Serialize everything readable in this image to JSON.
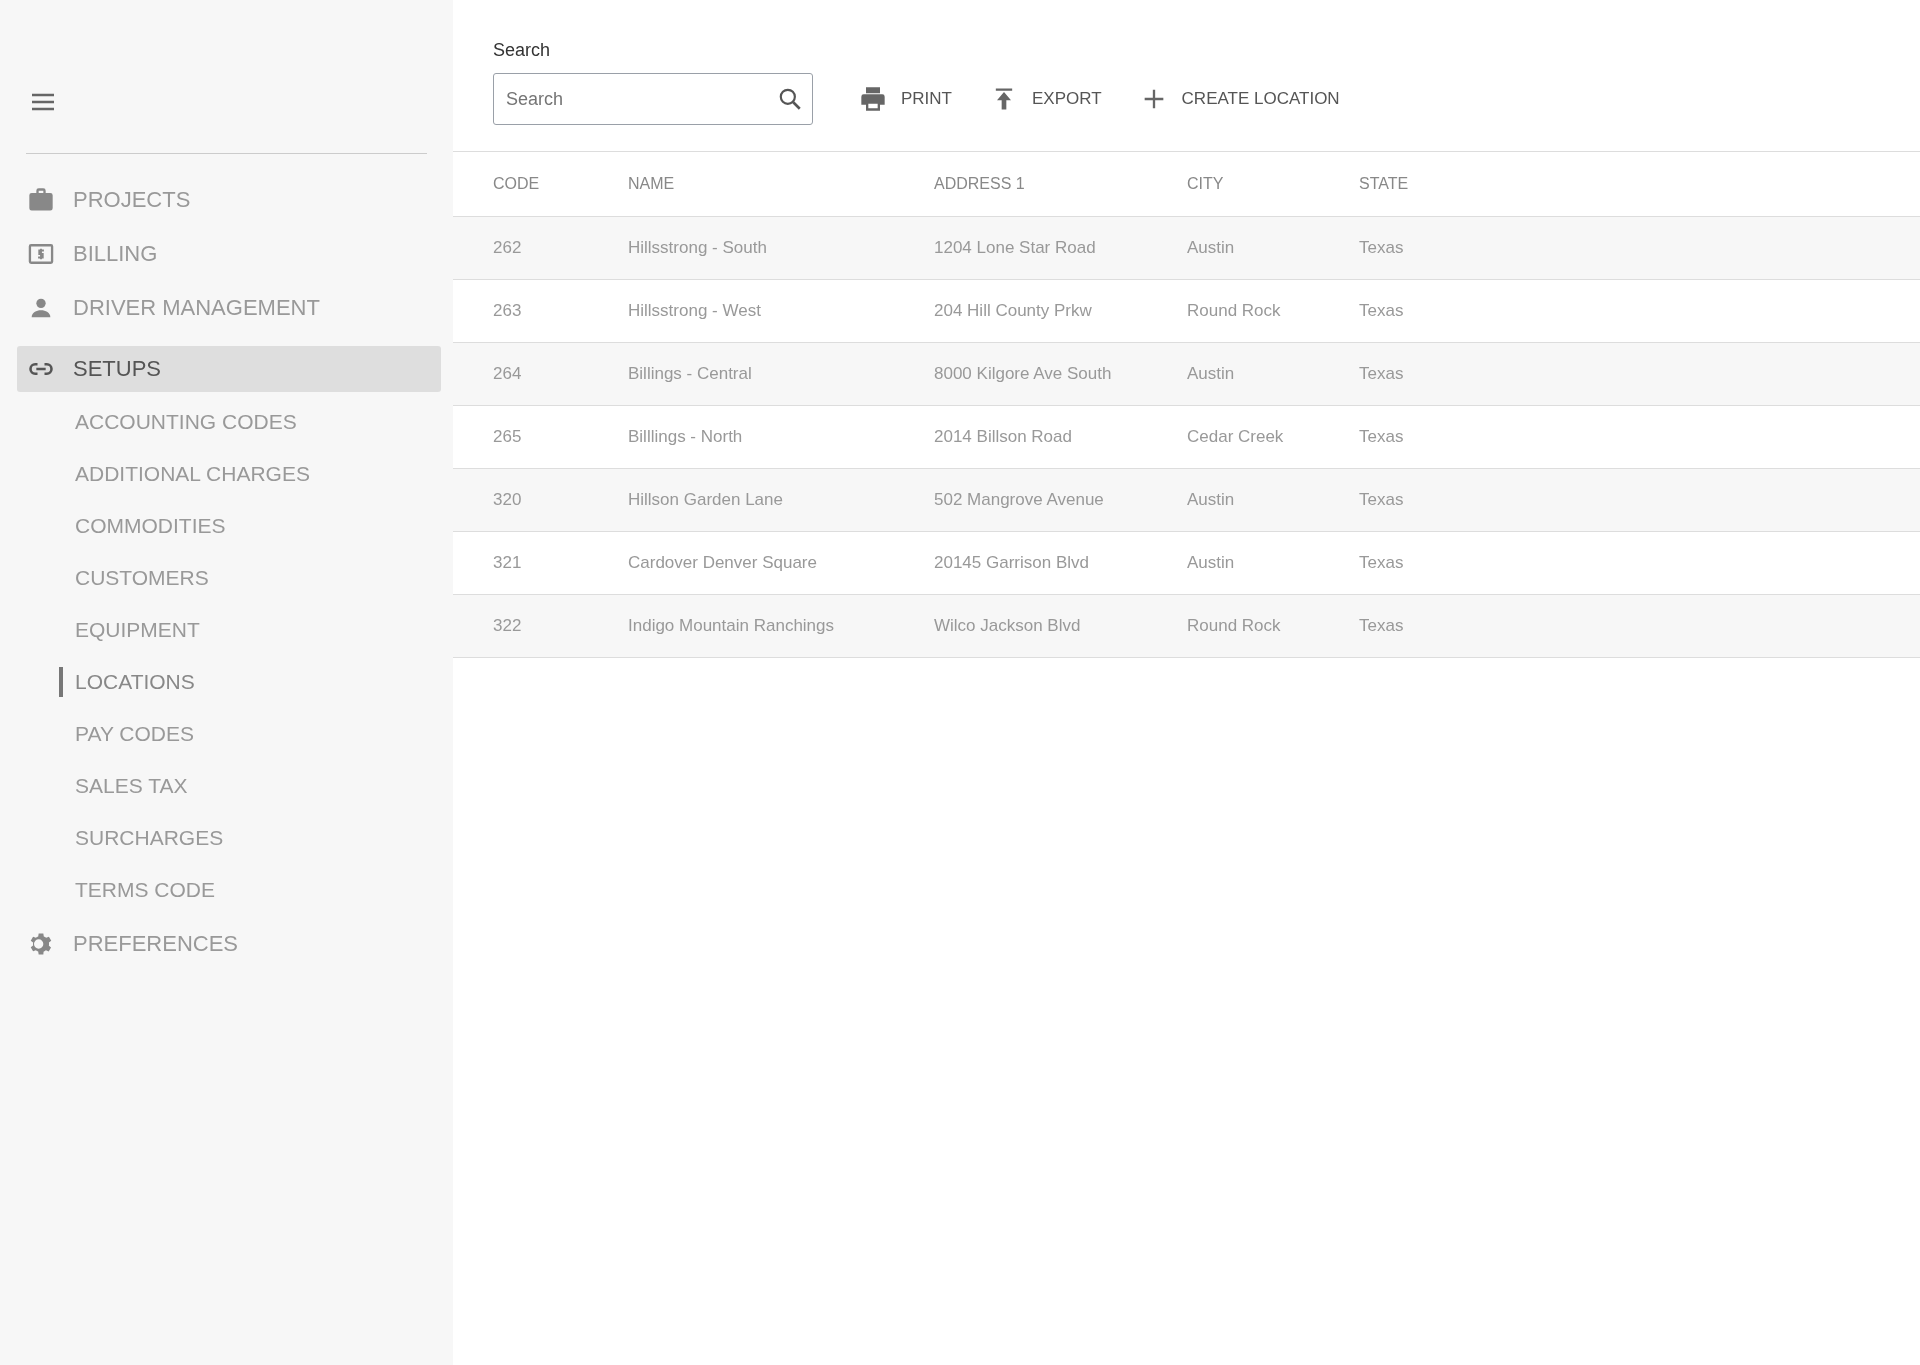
{
  "sidebar": {
    "items": [
      {
        "label": "PROJECTS",
        "selected": false
      },
      {
        "label": "BILLING",
        "selected": false
      },
      {
        "label": "DRIVER MANAGEMENT",
        "selected": false
      },
      {
        "label": "SETUPS",
        "selected": true,
        "children": [
          {
            "label": "ACCOUNTING CODES",
            "selected": false
          },
          {
            "label": "ADDITIONAL CHARGES",
            "selected": false
          },
          {
            "label": "COMMODITIES",
            "selected": false
          },
          {
            "label": "CUSTOMERS",
            "selected": false
          },
          {
            "label": "EQUIPMENT",
            "selected": false
          },
          {
            "label": "LOCATIONS",
            "selected": true
          },
          {
            "label": "PAY CODES",
            "selected": false
          },
          {
            "label": "SALES TAX",
            "selected": false
          },
          {
            "label": "SURCHARGES",
            "selected": false
          },
          {
            "label": "TERMS CODE",
            "selected": false
          }
        ]
      },
      {
        "label": "PREFERENCES",
        "selected": false
      }
    ]
  },
  "search": {
    "label": "Search",
    "placeholder": "Search"
  },
  "toolbar": [
    {
      "label": "PRINT"
    },
    {
      "label": "EXPORT"
    },
    {
      "label": "CREATE LOCATION"
    }
  ],
  "table": {
    "columns": [
      "CODE",
      "NAME",
      "ADDRESS 1",
      "CITY",
      "STATE"
    ],
    "rows": [
      [
        "262",
        "Hillsstrong - South",
        "1204 Lone Star Road",
        "Austin",
        "Texas"
      ],
      [
        "263",
        "Hillsstrong - West",
        "204 Hill County Prkw",
        "Round Rock",
        "Texas"
      ],
      [
        "264",
        "Billings - Central",
        "8000 Kilgore Ave South",
        "Austin",
        "Texas"
      ],
      [
        "265",
        "Billlings - North",
        "2014 Billson Road",
        "Cedar Creek",
        "Texas"
      ],
      [
        "320",
        "Hillson Garden Lane",
        "502 Mangrove Avenue",
        "Austin",
        "Texas"
      ],
      [
        "321",
        "Cardover Denver Square",
        "20145 Garrison Blvd",
        "Austin",
        "Texas"
      ],
      [
        "322",
        "Indigo Mountain Ranchings",
        "Wilco Jackson Blvd",
        "Round Rock",
        "Texas"
      ]
    ]
  }
}
